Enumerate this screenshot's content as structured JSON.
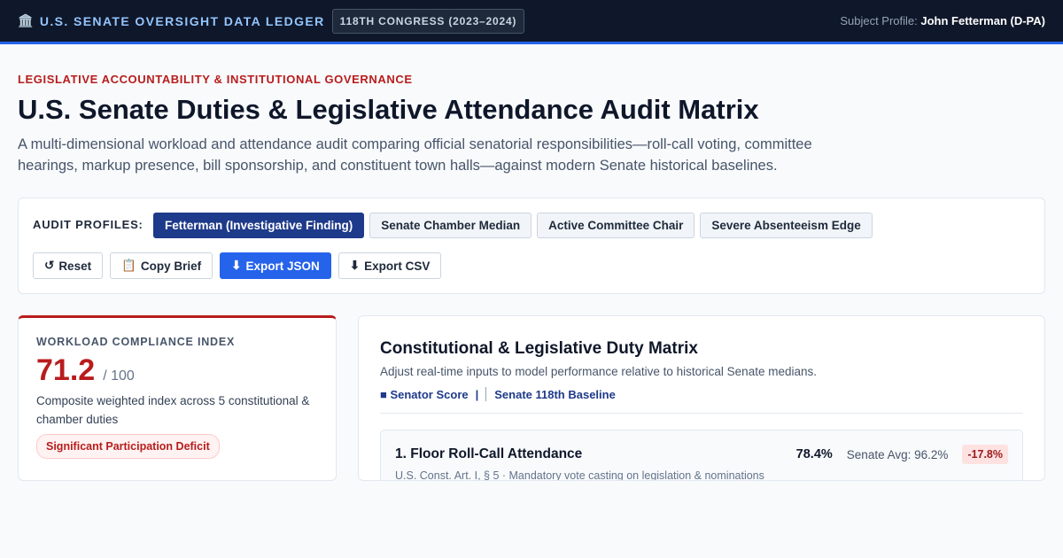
{
  "header": {
    "brand_icon": "🏛️",
    "brand": "U.S. SENATE OVERSIGHT DATA LEDGER",
    "congress": "118TH CONGRESS (2023–2024)",
    "subject_label": "Subject Profile:",
    "subject_name": "John Fetterman (D-PA)"
  },
  "page": {
    "kicker": "LEGISLATIVE ACCOUNTABILITY & INSTITUTIONAL GOVERNANCE",
    "title": "U.S. Senate Duties & Legislative Attendance Audit Matrix",
    "description": "A multi-dimensional workload and attendance audit comparing official senatorial responsibilities—roll-call voting, committee hearings, markup presence, bill sponsorship, and constituent town halls—against modern Senate historical baselines."
  },
  "controls": {
    "profiles_label": "AUDIT PROFILES:",
    "profiles": [
      "Fetterman (Investigative Finding)",
      "Senate Chamber Median",
      "Active Committee Chair",
      "Severe Absenteeism Edge"
    ],
    "active_profile": 0,
    "actions": [
      {
        "icon": "↺",
        "label": "Reset"
      },
      {
        "icon": "📋",
        "label": "Copy Brief"
      },
      {
        "icon": "⬇",
        "label": "Export JSON"
      },
      {
        "icon": "⬇",
        "label": "Export CSV"
      }
    ]
  },
  "index_card": {
    "label": "WORKLOAD COMPLIANCE INDEX",
    "score": "71.2",
    "out_of": "/ 100",
    "description": "Composite weighted index across 5 constitutional & chamber duties",
    "badge": "Significant Participation Deficit",
    "accent": "#b91c1c"
  },
  "matrix": {
    "title": "Constitutional & Legislative Duty Matrix",
    "subtitle": "Adjust real-time inputs to model performance relative to historical Senate medians.",
    "legend_senator": "■ Senator Score",
    "legend_sep": "|",
    "legend_baseline": "Senate 118th Baseline",
    "duties": [
      {
        "name": "1. Floor Roll-Call Attendance",
        "score": "78.4%",
        "avg": "Senate Avg: 96.2%",
        "delta": "-17.8%",
        "note": "U.S. Const. Art. I, § 5 · Mandatory vote casting on legislation & nominations"
      }
    ]
  },
  "colors": {
    "navy": "#0f172a",
    "accent_blue": "#2563eb",
    "alert_red": "#b91c1c",
    "active_profile": "#1e3a8a"
  }
}
